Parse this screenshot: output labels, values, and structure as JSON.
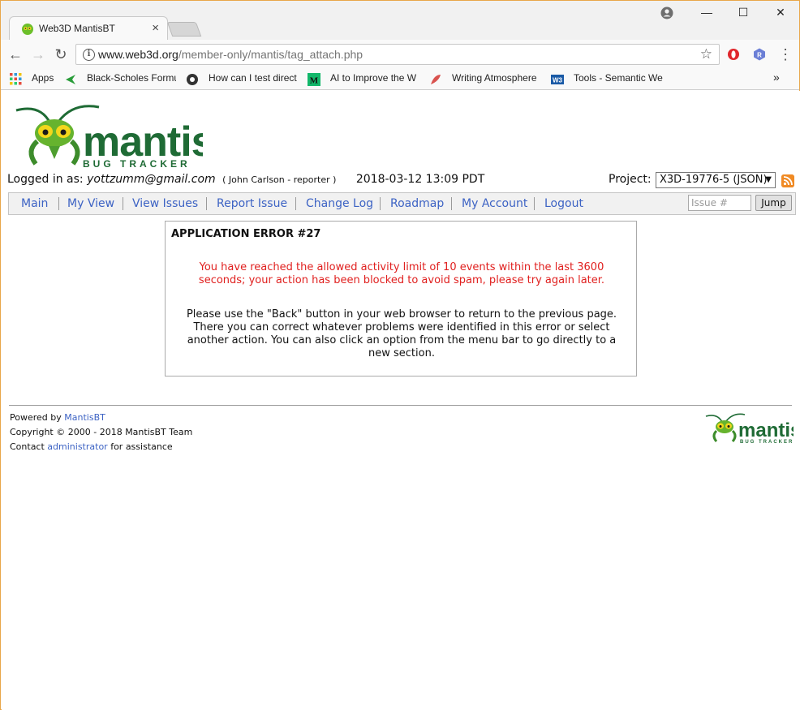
{
  "browser": {
    "tab_title": "Web3D MantisBT",
    "tab_close": "×",
    "url_host": "www.web3d.org",
    "url_path": "/member-only/mantis/tag_attach.php",
    "window_controls": {
      "minimize": "—",
      "maximize": "☐",
      "close": "✕"
    },
    "bookmarks": [
      {
        "label": "Apps",
        "icon": "apps-grid-icon"
      },
      {
        "label": "Black-Scholes Formu",
        "icon": "arrow-bookmark-icon"
      },
      {
        "label": "How can I test direct",
        "icon": "unity-bookmark-icon"
      },
      {
        "label": "AI to Improve the W",
        "icon": "medium-bookmark-icon"
      },
      {
        "label": "Writing Atmosphere",
        "icon": "feather-bookmark-icon"
      },
      {
        "label": "Tools - Semantic We",
        "icon": "w3c-bookmark-icon"
      }
    ],
    "bookmarks_overflow": "»"
  },
  "header": {
    "logo_text": "mantis",
    "logo_subtext": "BUG TRACKER",
    "logged_in_label": "Logged in as:",
    "user_email": "yottzumm@gmail.com",
    "user_realname": "( John Carlson - reporter )",
    "timestamp": "2018-03-12 13:09 PDT",
    "project_label": "Project:",
    "project_value": "X3D-19776-5 (JSON)"
  },
  "menu": {
    "items": [
      "Main",
      "My View",
      "View Issues",
      "Report Issue",
      "Change Log",
      "Roadmap",
      "My Account",
      "Logout"
    ],
    "issue_placeholder": "Issue #",
    "jump_label": "Jump"
  },
  "error": {
    "title": "APPLICATION ERROR #27",
    "message": "You have reached the allowed activity limit of 10 events within the last 3600 seconds; your action has been blocked to avoid spam, please try again later.",
    "help": "Please use the \"Back\" button in your web browser to return to the previous page. There you can correct whatever problems were identified in this error or select another action. You can also click an option from the menu bar to go directly to a new section."
  },
  "footer": {
    "powered_prefix": "Powered by ",
    "powered_link": "MantisBT",
    "copyright": "Copyright © 2000 - 2018 MantisBT Team",
    "contact_prefix": "Contact ",
    "contact_link": "administrator",
    "contact_suffix": " for assistance"
  },
  "colors": {
    "link_blue": "#3d63c4",
    "error_red": "#e0201f",
    "mantis_green": "#1f6b35",
    "window_border": "#e8a64a"
  }
}
